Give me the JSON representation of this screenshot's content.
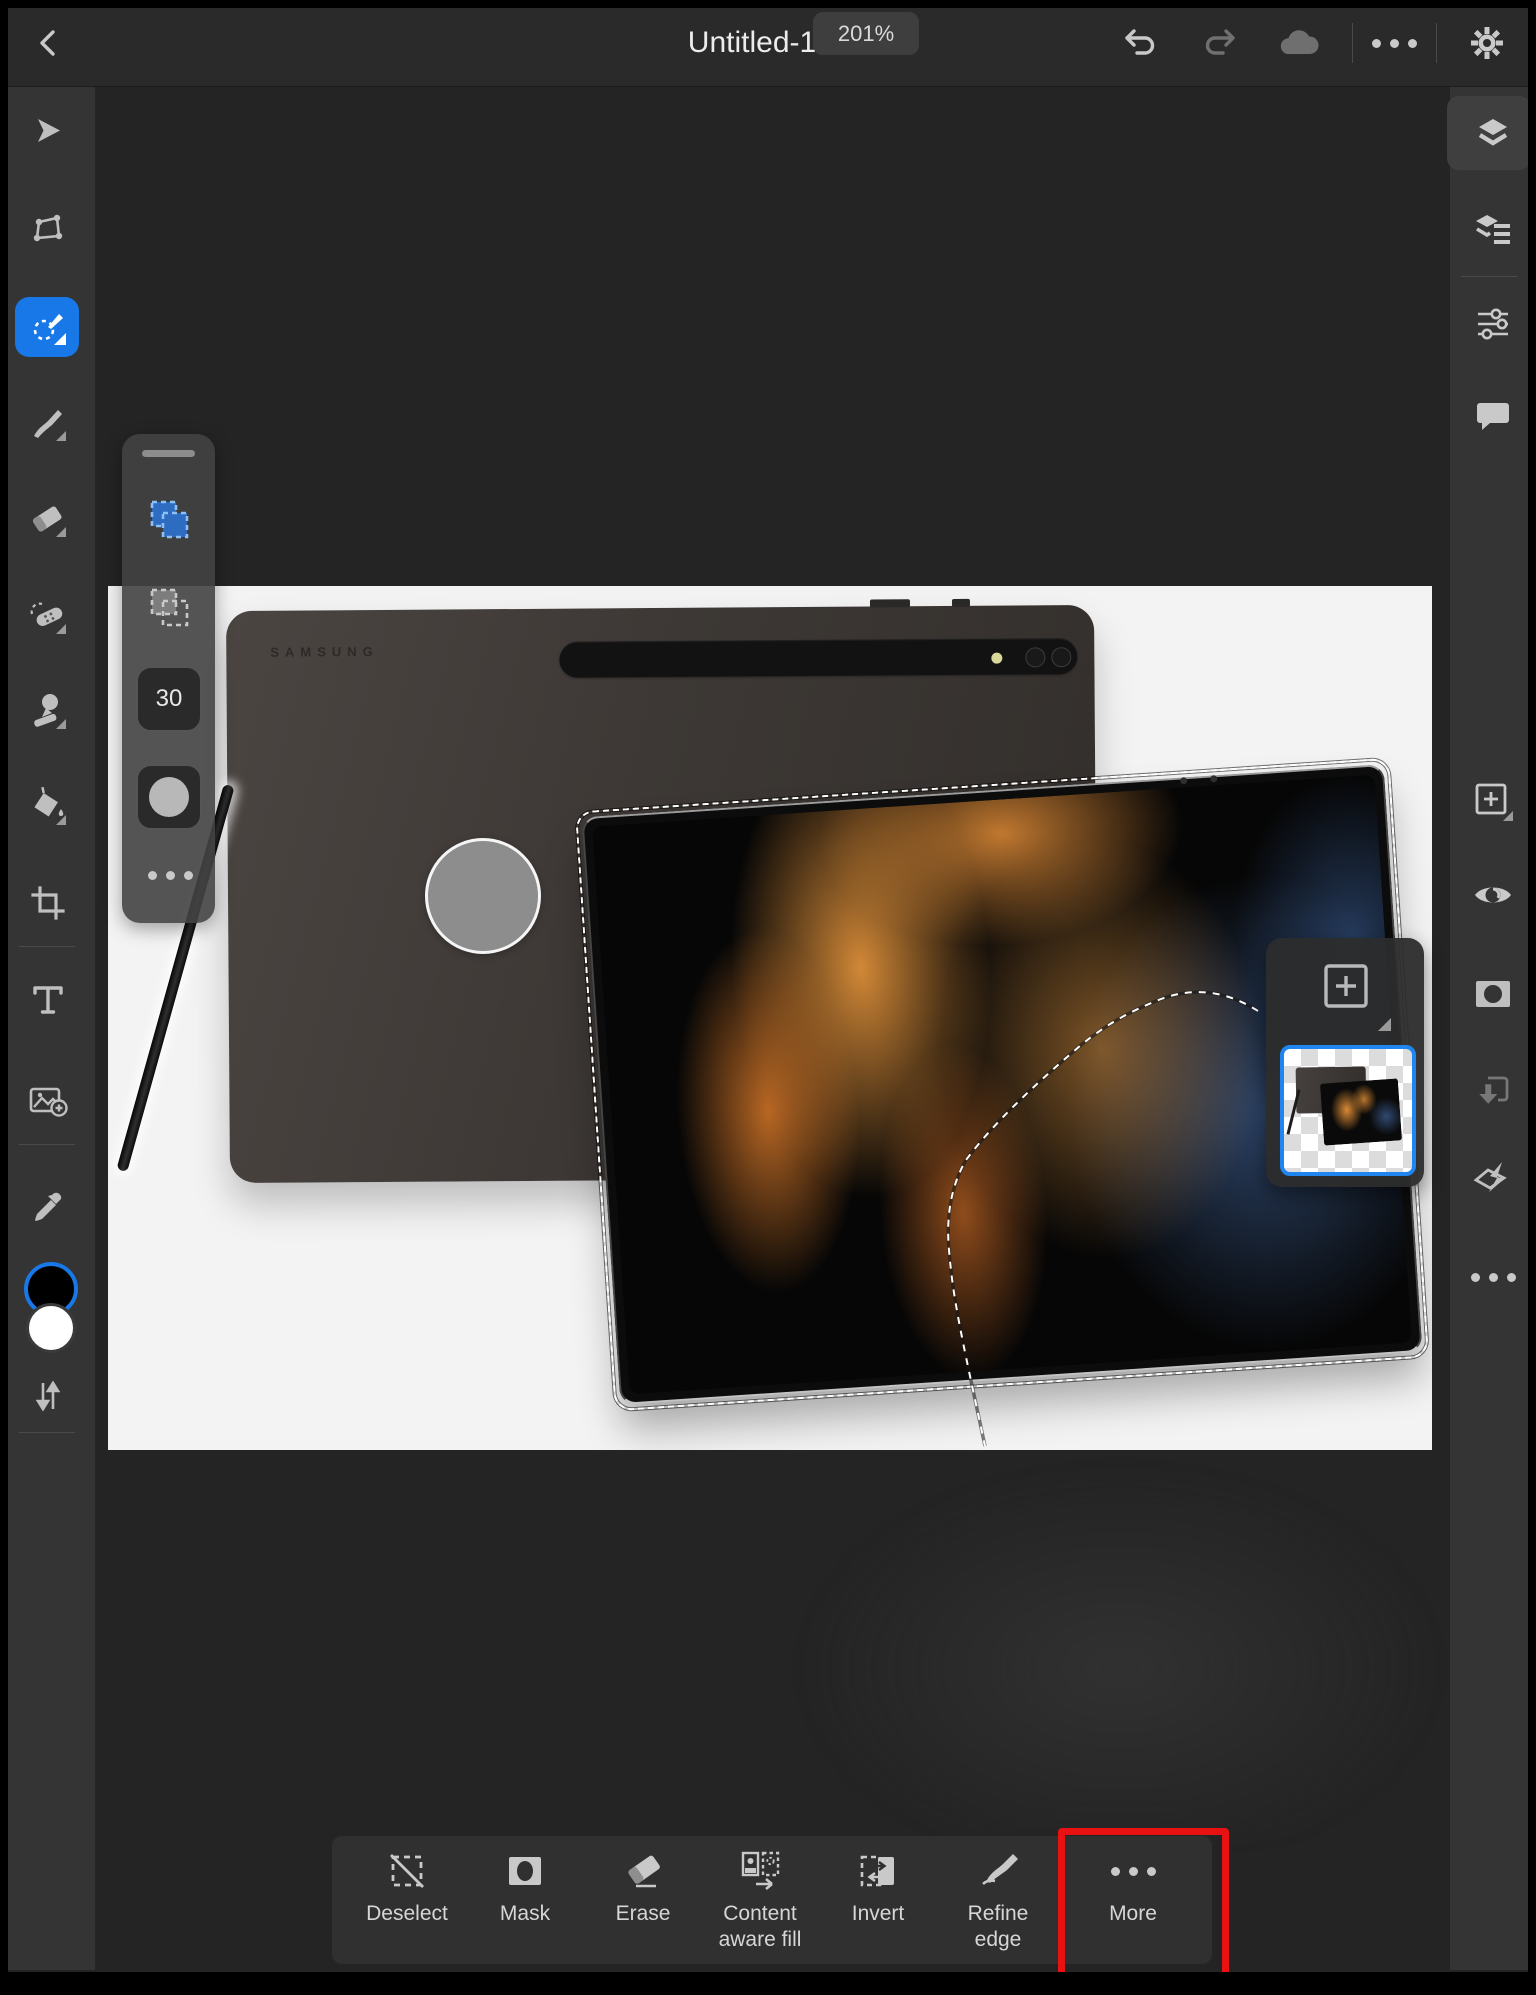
{
  "topbar": {
    "title": "Untitled-1",
    "zoom_badge": "201%",
    "icons": [
      "back",
      "document-title-dropdown",
      "zoom-level",
      "undo",
      "redo",
      "cloud-sync",
      "more-options",
      "settings"
    ]
  },
  "left_toolbar": {
    "active_tool": "selection-brush-tool",
    "icons": [
      "move-tool",
      "transform-tool",
      "selection-brush-tool",
      "brush-tool",
      "eraser-tool",
      "healing-tool",
      "clone-stamp-tool",
      "fill-tool",
      "crop-tool",
      "type-tool",
      "place-image-tool",
      "eyedropper-tool",
      "foreground-background-colors",
      "swap-colors"
    ]
  },
  "tool_options": {
    "size_value": "30",
    "icons": [
      "drag-handle",
      "add-selection",
      "subtract-selection",
      "brush-size",
      "brush-hardness",
      "more-options"
    ]
  },
  "right_toolbar": {
    "icons": [
      "layers-panel",
      "layer-properties",
      "adjustments",
      "comments",
      "add-layer",
      "layer-visibility",
      "layer-mask",
      "clip-layer",
      "layer-effects",
      "more-options"
    ]
  },
  "layers_flyout": {
    "icons": [
      "add-layer",
      "layer-thumbnail"
    ]
  },
  "canvas": {
    "back_tablet_logo": "SAMSUNG",
    "selection": "marching-ants around front tablet"
  },
  "bottom_bar": {
    "items": [
      {
        "label": "Deselect"
      },
      {
        "label": "Mask"
      },
      {
        "label": "Erase"
      },
      {
        "label": "Content aware fill"
      },
      {
        "label": "Invert"
      },
      {
        "label": "Refine edge"
      },
      {
        "label": "More"
      }
    ]
  },
  "colors": {
    "active_tool_blue": "#1878e8",
    "selection_border_blue": "#1f86f0",
    "annotation_red": "#e81212",
    "workspace_bg": "#242424",
    "rail_bg": "#343434",
    "topbar_bg": "#2a2a2a",
    "canvas_bg": "#f3f3f3"
  }
}
